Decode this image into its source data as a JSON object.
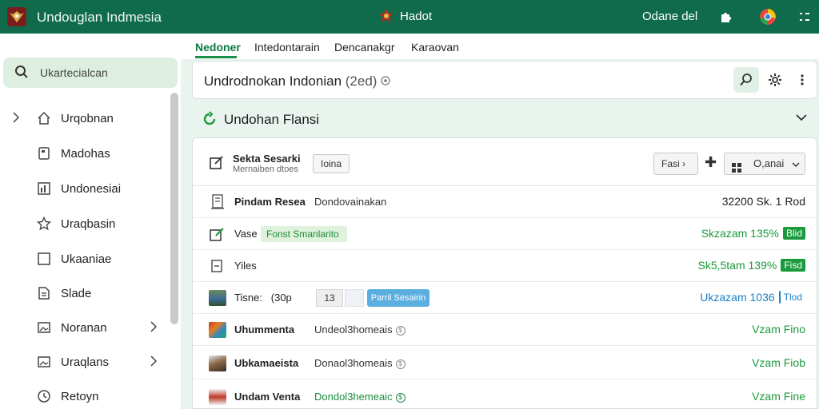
{
  "topbar": {
    "app_title": "Undouglan Indmesia",
    "center_label": "Hadot",
    "user_label": "Odane del"
  },
  "sidebar": {
    "search_placeholder": "Ukartecialcan",
    "items": [
      {
        "label": "Urqobnan",
        "icon": "home-icon"
      },
      {
        "label": "Madohas",
        "icon": "document-icon"
      },
      {
        "label": "Undonesiai",
        "icon": "bar-chart-icon"
      },
      {
        "label": "Uraqbasin",
        "icon": "star-icon"
      },
      {
        "label": "Ukaaniae",
        "icon": "square-icon"
      },
      {
        "label": "Slade",
        "icon": "file-icon"
      },
      {
        "label": "Noranan",
        "icon": "image-icon"
      },
      {
        "label": "Uraqlans",
        "icon": "image-icon"
      },
      {
        "label": "Retoyn",
        "icon": "clock-icon"
      }
    ]
  },
  "tabs": [
    "Nedoner",
    "Intedontarain",
    "Dencanakgr",
    "Karaovan"
  ],
  "search": {
    "query": "Undrodnokan Indonian",
    "query_suffix": "(2ed)"
  },
  "section": {
    "title": "Undohan Flansi"
  },
  "panel": {
    "title": "Sekta Sesarki",
    "subtitle": "Mernaiben dtoes",
    "chip": "Ioina",
    "sort_label": "Fasi",
    "view_label": "O,anai"
  },
  "rows": [
    {
      "name": "Pindam Resea",
      "desc": "Dondovainakan",
      "value": "32200 Sk. 1 Rod",
      "badge": ""
    },
    {
      "name": "Vase",
      "tag": "Fonst Smanlarito",
      "value": "Skzazam 135%",
      "badge": "Blid"
    },
    {
      "name": "Yiles",
      "value": "Sk5,5tam 139%",
      "badge": "Fisd"
    },
    {
      "name": "Tisne:",
      "name_suffix": "(30p",
      "qty": "13",
      "tag": "Parril Sesairin",
      "value": "Ukzazam 1036",
      "badge": "Tlod"
    },
    {
      "name": "Uhummenta",
      "desc": "Undeol3homeais",
      "value": "Vzam Fino"
    },
    {
      "name": "Ubkamaeista",
      "desc": "Donaol3homeais",
      "value": "Vzam Fiob"
    },
    {
      "name": "Undam Venta",
      "desc": "Dondol3hemeaic",
      "value": "Vzam Fine"
    }
  ],
  "colors": {
    "header_green": "#0f6b4b",
    "accent_green": "#1a9a3c",
    "accent_blue": "#1a7fc7"
  }
}
